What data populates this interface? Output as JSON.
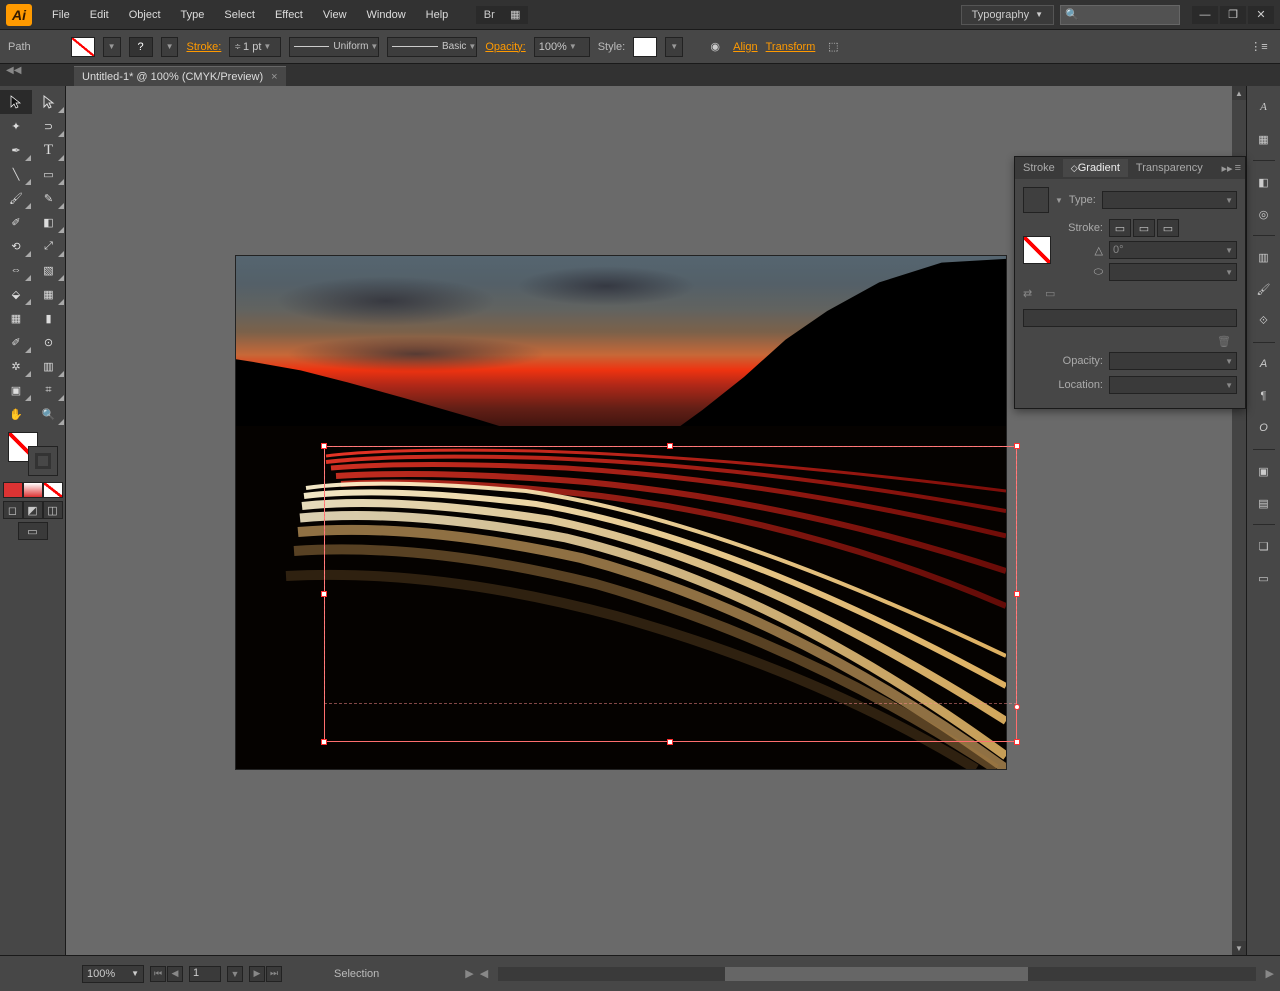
{
  "menubar": {
    "items": [
      "File",
      "Edit",
      "Object",
      "Type",
      "Select",
      "Effect",
      "View",
      "Window",
      "Help"
    ],
    "workspace": "Typography",
    "search_placeholder": "🔍"
  },
  "controlbar": {
    "selection_type": "Path",
    "stroke_label": "Stroke:",
    "stroke_weight": "1 pt",
    "uniform": "Uniform",
    "basic": "Basic",
    "opacity_label": "Opacity:",
    "opacity_value": "100%",
    "style_label": "Style:",
    "align": "Align",
    "transform": "Transform"
  },
  "document": {
    "tab_title": "Untitled-1* @ 100% (CMYK/Preview)"
  },
  "gradient_panel": {
    "tabs": [
      "Stroke",
      "Gradient",
      "Transparency"
    ],
    "active_tab": 1,
    "type_label": "Type:",
    "stroke_label": "Stroke:",
    "angle_value": "0°",
    "opacity_label": "Opacity:",
    "location_label": "Location:"
  },
  "statusbar": {
    "zoom": "100%",
    "artboard_num": "1",
    "tool_hint": "Selection"
  },
  "tools": [
    [
      "selection-tool",
      "direct-selection-tool"
    ],
    [
      "magic-wand-tool",
      "lasso-tool"
    ],
    [
      "pen-tool",
      "type-tool"
    ],
    [
      "line-tool",
      "rectangle-tool"
    ],
    [
      "paintbrush-tool",
      "pencil-tool"
    ],
    [
      "blob-brush-tool",
      "eraser-tool"
    ],
    [
      "rotate-tool",
      "scale-tool"
    ],
    [
      "width-tool",
      "free-transform-tool"
    ],
    [
      "shape-builder-tool",
      "perspective-tool"
    ],
    [
      "mesh-tool",
      "gradient-tool"
    ],
    [
      "eyedropper-tool",
      "blend-tool"
    ],
    [
      "symbol-sprayer-tool",
      "graph-tool"
    ],
    [
      "artboard-tool",
      "slice-tool"
    ],
    [
      "hand-tool",
      "zoom-tool"
    ]
  ],
  "right_dock": [
    "character-panel-icon",
    "paragraph-panel-icon",
    "",
    "color-panel-icon",
    "color-guide-icon",
    "",
    "swatches-panel-icon",
    "brushes-panel-icon",
    "symbols-panel-icon",
    "",
    "stroke-panel-icon",
    "gradient-panel-icon",
    "transparency-panel-icon",
    "",
    "appearance-panel-icon",
    "graphic-styles-icon",
    "",
    "layers-panel-icon",
    "artboards-panel-icon"
  ]
}
